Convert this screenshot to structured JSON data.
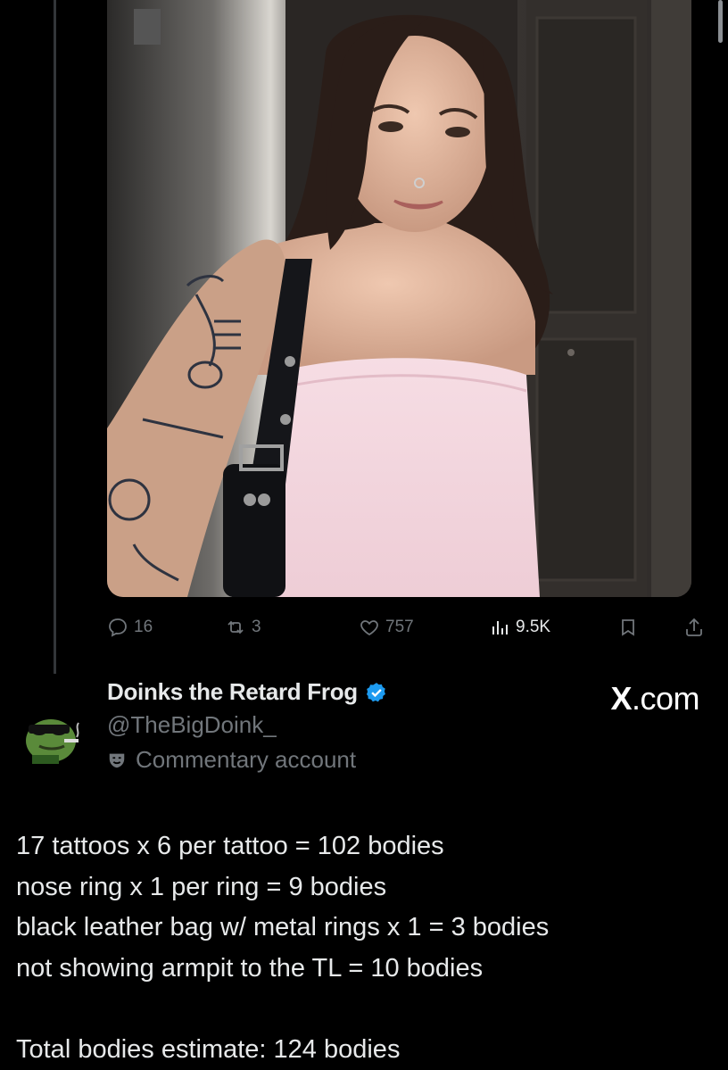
{
  "tweet": {
    "photo": {
      "subject": "selfie-photo"
    },
    "actions": {
      "replies": "16",
      "reposts": "3",
      "likes": "757",
      "views": "9.5K"
    }
  },
  "author": {
    "display_name": "Doinks the Retard Frog",
    "handle": "@TheBigDoink_",
    "label": "Commentary account",
    "verified_color": "#1d9bf0"
  },
  "watermark": {
    "text": ".com",
    "mark": "X"
  },
  "body": {
    "lines": [
      "17 tattoos x 6 per tattoo = 102 bodies",
      "nose ring x 1 per ring = 9 bodies",
      "black leather bag w/ metal rings x 1 = 3 bodies",
      "not showing armpit to the TL = 10 bodies",
      "",
      "Total bodies estimate: 124 bodies"
    ]
  },
  "colors": {
    "background": "#000000",
    "muted": "#71767b",
    "text": "#e7e9ea",
    "accent": "#1d9bf0"
  }
}
